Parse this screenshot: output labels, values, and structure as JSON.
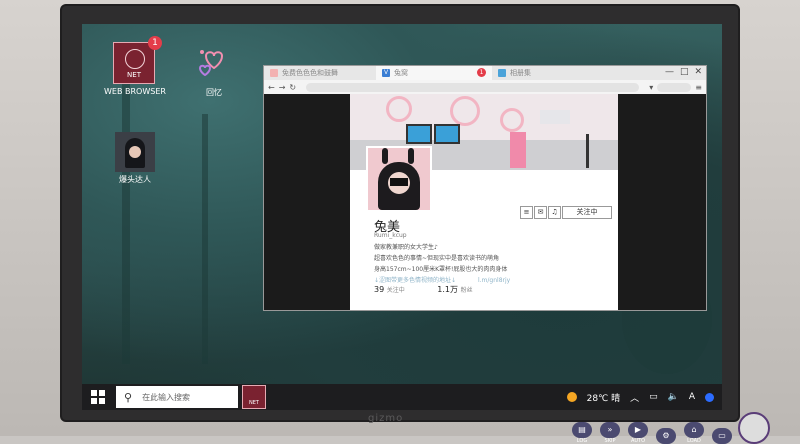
{
  "monitor": {
    "brand": "gizmo"
  },
  "desktop": {
    "icons": [
      {
        "label": "WEB BROWSER",
        "badge": "1",
        "icon": "net-icon",
        "icon_text": "NET"
      },
      {
        "label": "回忆",
        "icon": "hearts-icon"
      },
      {
        "label": "爆头达人",
        "icon": "portrait-icon"
      }
    ]
  },
  "browser": {
    "tabs": [
      {
        "title": "免费色色色和鼓舞",
        "active": false
      },
      {
        "title": "兔窝",
        "active": true,
        "badge": "1"
      },
      {
        "title": "相册集",
        "active": false
      }
    ],
    "nav": {
      "back": "←",
      "forward": "→",
      "refresh": "↻"
    },
    "window_controls": {
      "minimize": "—",
      "maximize": "□",
      "close": "✕"
    },
    "profile": {
      "name": "兔美",
      "handle": "Rumi_kcup",
      "bio": [
        "做家教兼职的女大学生♪",
        "超喜欢色色的事情~但现实中是喜欢读书的萌角",
        "身高157cm~100厘米K罩杯!屁股也大的肉肉身体"
      ],
      "bio_link_prefix": "↓涩图带更多色情视频的地址↓",
      "bio_link": "l.m/gnl8rjy",
      "following_count": "39",
      "following_label": "关注中",
      "followers_count": "1.1万",
      "followers_label": "粉丝",
      "follow_button": "关注中"
    }
  },
  "taskbar": {
    "search_placeholder": "在此输入搜索",
    "weather": "28℃ 晴"
  },
  "vn_menu": [
    "LOG",
    "SKIP",
    "AUTO",
    "",
    "LOAD",
    ""
  ],
  "colors": {
    "accent": "#e43d4a",
    "screen_bg": "#2b4a4a",
    "taskbar": "#1d1d1f"
  }
}
